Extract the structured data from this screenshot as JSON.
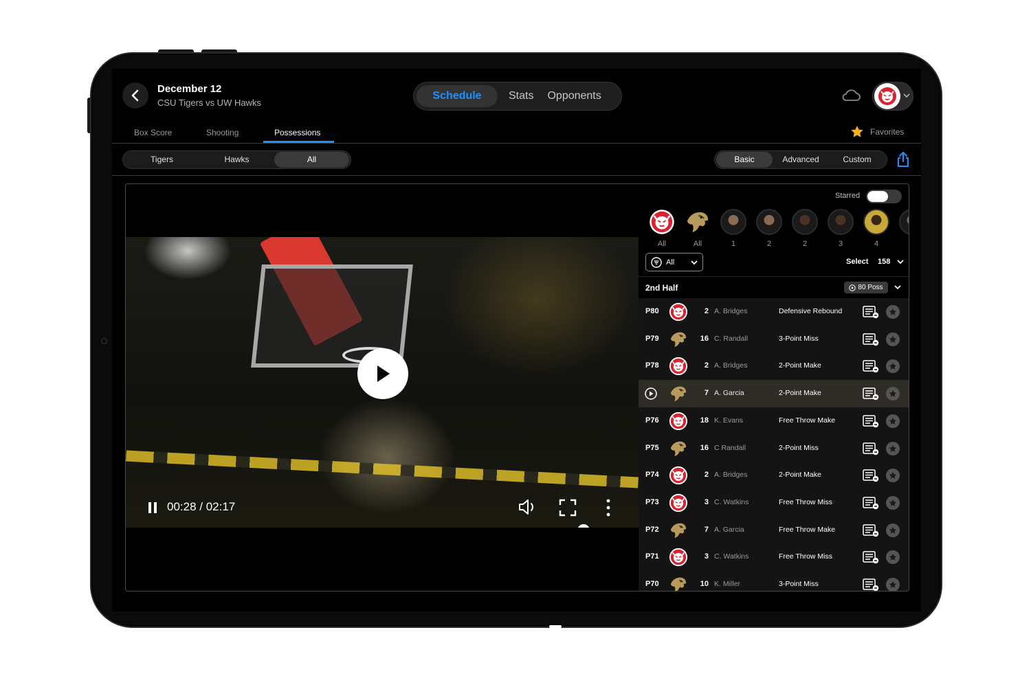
{
  "header": {
    "date": "December 12",
    "matchup": "CSU Tigers vs UW Hawks",
    "main_tabs": [
      {
        "label": "Schedule",
        "active": true
      },
      {
        "label": "Stats",
        "active": false
      },
      {
        "label": "Opponents",
        "active": false
      }
    ]
  },
  "sub_tabs": [
    {
      "label": "Box Score",
      "active": false
    },
    {
      "label": "Shooting",
      "active": false
    },
    {
      "label": "Possessions",
      "active": true
    }
  ],
  "favorites_label": "Favorites",
  "team_filter": [
    {
      "label": "Tigers",
      "active": false
    },
    {
      "label": "Hawks",
      "active": false
    },
    {
      "label": "All",
      "active": true
    }
  ],
  "mode_filter": [
    {
      "label": "Basic",
      "active": true
    },
    {
      "label": "Advanced",
      "active": false
    },
    {
      "label": "Custom",
      "active": false
    }
  ],
  "video": {
    "time": "00:28 / 02:17",
    "progress": 0.92
  },
  "starred_label": "Starred",
  "player_filters": [
    {
      "label": "All",
      "type": "tigers"
    },
    {
      "label": "All",
      "type": "hawks"
    },
    {
      "label": "1",
      "type": "player"
    },
    {
      "label": "2",
      "type": "player"
    },
    {
      "label": "2",
      "type": "player-dark"
    },
    {
      "label": "3",
      "type": "player-dark"
    },
    {
      "label": "4",
      "type": "player-gold"
    }
  ],
  "event_filter": "All",
  "select_label": "Select",
  "select_count": "158",
  "half": {
    "title": "2nd Half",
    "possessions": "80 Poss"
  },
  "possessions": [
    {
      "id": "P80",
      "team": "tigers",
      "number": "2",
      "player": "A. Bridges",
      "event": "Defensive Rebound",
      "active": false
    },
    {
      "id": "P79",
      "team": "hawks",
      "number": "16",
      "player": "C. Randall",
      "event": "3-Point Miss",
      "active": false
    },
    {
      "id": "P78",
      "team": "tigers",
      "number": "2",
      "player": "A. Bridges",
      "event": "2-Point Make",
      "active": false
    },
    {
      "id": "",
      "team": "hawks",
      "number": "7",
      "player": "A. Garcia",
      "event": "2-Point Make",
      "active": true
    },
    {
      "id": "P76",
      "team": "tigers",
      "number": "18",
      "player": "K. Evans",
      "event": "Free Throw Make",
      "active": false
    },
    {
      "id": "P75",
      "team": "hawks",
      "number": "16",
      "player": "C Randall",
      "event": "2-Point Miss",
      "active": false
    },
    {
      "id": "P74",
      "team": "tigers",
      "number": "2",
      "player": "A. Bridges",
      "event": "2-Point Make",
      "active": false
    },
    {
      "id": "P73",
      "team": "tigers",
      "number": "3",
      "player": "C. Watkins",
      "event": "Free Throw Miss",
      "active": false
    },
    {
      "id": "P72",
      "team": "hawks",
      "number": "7",
      "player": "A. Garcia",
      "event": "Free Throw Make",
      "active": false
    },
    {
      "id": "P71",
      "team": "tigers",
      "number": "3",
      "player": "C. Watkins",
      "event": "Free Throw Miss",
      "active": false
    },
    {
      "id": "P70",
      "team": "hawks",
      "number": "10",
      "player": "K. Miller",
      "event": "3-Point Miss",
      "active": false
    }
  ],
  "colors": {
    "accent": "#1e90ff",
    "tigers_red": "#d9232e",
    "hawks_gold": "#b89a5a",
    "favorite_star": "#f5b120"
  }
}
